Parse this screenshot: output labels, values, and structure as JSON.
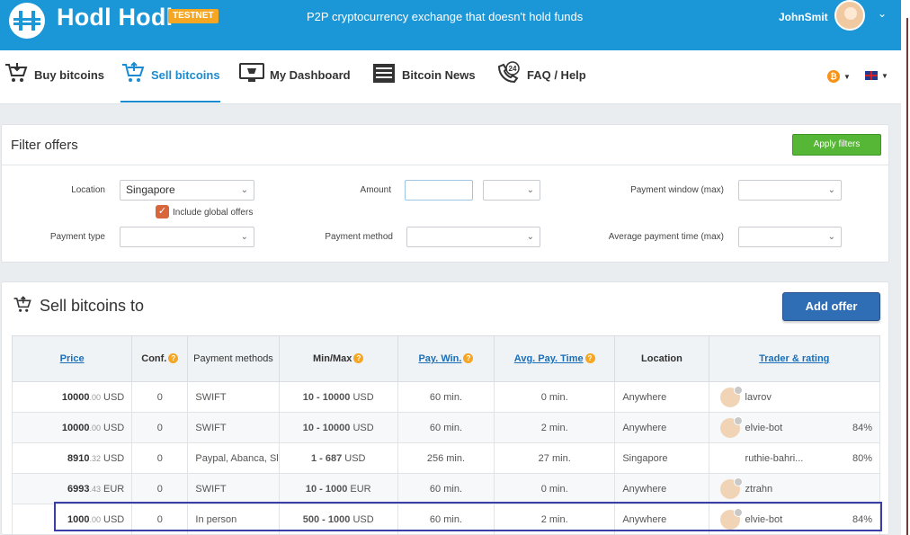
{
  "header": {
    "brand": "Hodl Hodl",
    "badge": "TESTNET",
    "tagline": "P2P cryptocurrency exchange that doesn't hold funds",
    "username": "JohnSmit",
    "brand_color": "#1b96d7"
  },
  "nav": {
    "items": [
      {
        "label": "Buy bitcoins"
      },
      {
        "label": "Sell bitcoins"
      },
      {
        "label": "My Dashboard"
      },
      {
        "label": "Bitcoin News"
      },
      {
        "label": "FAQ / Help"
      }
    ],
    "active": "Sell bitcoins",
    "currency_symbol": "₿"
  },
  "filter": {
    "title": "Filter offers",
    "apply_label": "Apply filters",
    "location_label": "Location",
    "location_value": "Singapore",
    "include_global_label": "Include global offers",
    "amount_label": "Amount",
    "amount_value": "",
    "payment_window_label": "Payment window (max)",
    "payment_type_label": "Payment type",
    "payment_method_label": "Payment method",
    "avg_payment_time_label": "Average payment time (max)"
  },
  "offers": {
    "title": "Sell bitcoins to",
    "add_label": "Add offer",
    "columns": {
      "price": "Price",
      "conf": "Conf.",
      "payment_methods": "Payment methods",
      "minmax": "Min/Max",
      "pay_win": "Pay. Win.",
      "avg_pay_time": "Avg. Pay. Time",
      "location": "Location",
      "trader": "Trader & rating"
    },
    "rows": [
      {
        "price_int": "10000",
        "price_dec": ".00",
        "currency": "USD",
        "conf": "0",
        "method": "SWIFT",
        "minmax": "10 - 10000",
        "minmax_cur": "USD",
        "pay_win": "60 min.",
        "avg_time": "0 min.",
        "location": "Anywhere",
        "trader": "lavrov",
        "rating": ""
      },
      {
        "price_int": "10000",
        "price_dec": ".00",
        "currency": "USD",
        "conf": "0",
        "method": "SWIFT",
        "minmax": "10 - 10000",
        "minmax_cur": "USD",
        "pay_win": "60 min.",
        "avg_time": "2 min.",
        "location": "Anywhere",
        "trader": "elvie-bot",
        "rating": "84%"
      },
      {
        "price_int": "8910",
        "price_dec": ".32",
        "currency": "USD",
        "conf": "0",
        "method": "Paypal, Abanca, Sk",
        "minmax": "1 - 687",
        "minmax_cur": "USD",
        "pay_win": "256 min.",
        "avg_time": "27 min.",
        "location": "Singapore",
        "trader": "ruthie-bahri...",
        "rating": "80%"
      },
      {
        "price_int": "6993",
        "price_dec": ".43",
        "currency": "EUR",
        "conf": "0",
        "method": "SWIFT",
        "minmax": "10 - 1000",
        "minmax_cur": "EUR",
        "pay_win": "60 min.",
        "avg_time": "0 min.",
        "location": "Anywhere",
        "trader": "ztrahn",
        "rating": ""
      },
      {
        "price_int": "1000",
        "price_dec": ".00",
        "currency": "USD",
        "conf": "0",
        "method": "In person",
        "minmax": "500 - 1000",
        "minmax_cur": "USD",
        "pay_win": "60 min.",
        "avg_time": "2 min.",
        "location": "Anywhere",
        "trader": "elvie-bot",
        "rating": "84%"
      }
    ]
  }
}
